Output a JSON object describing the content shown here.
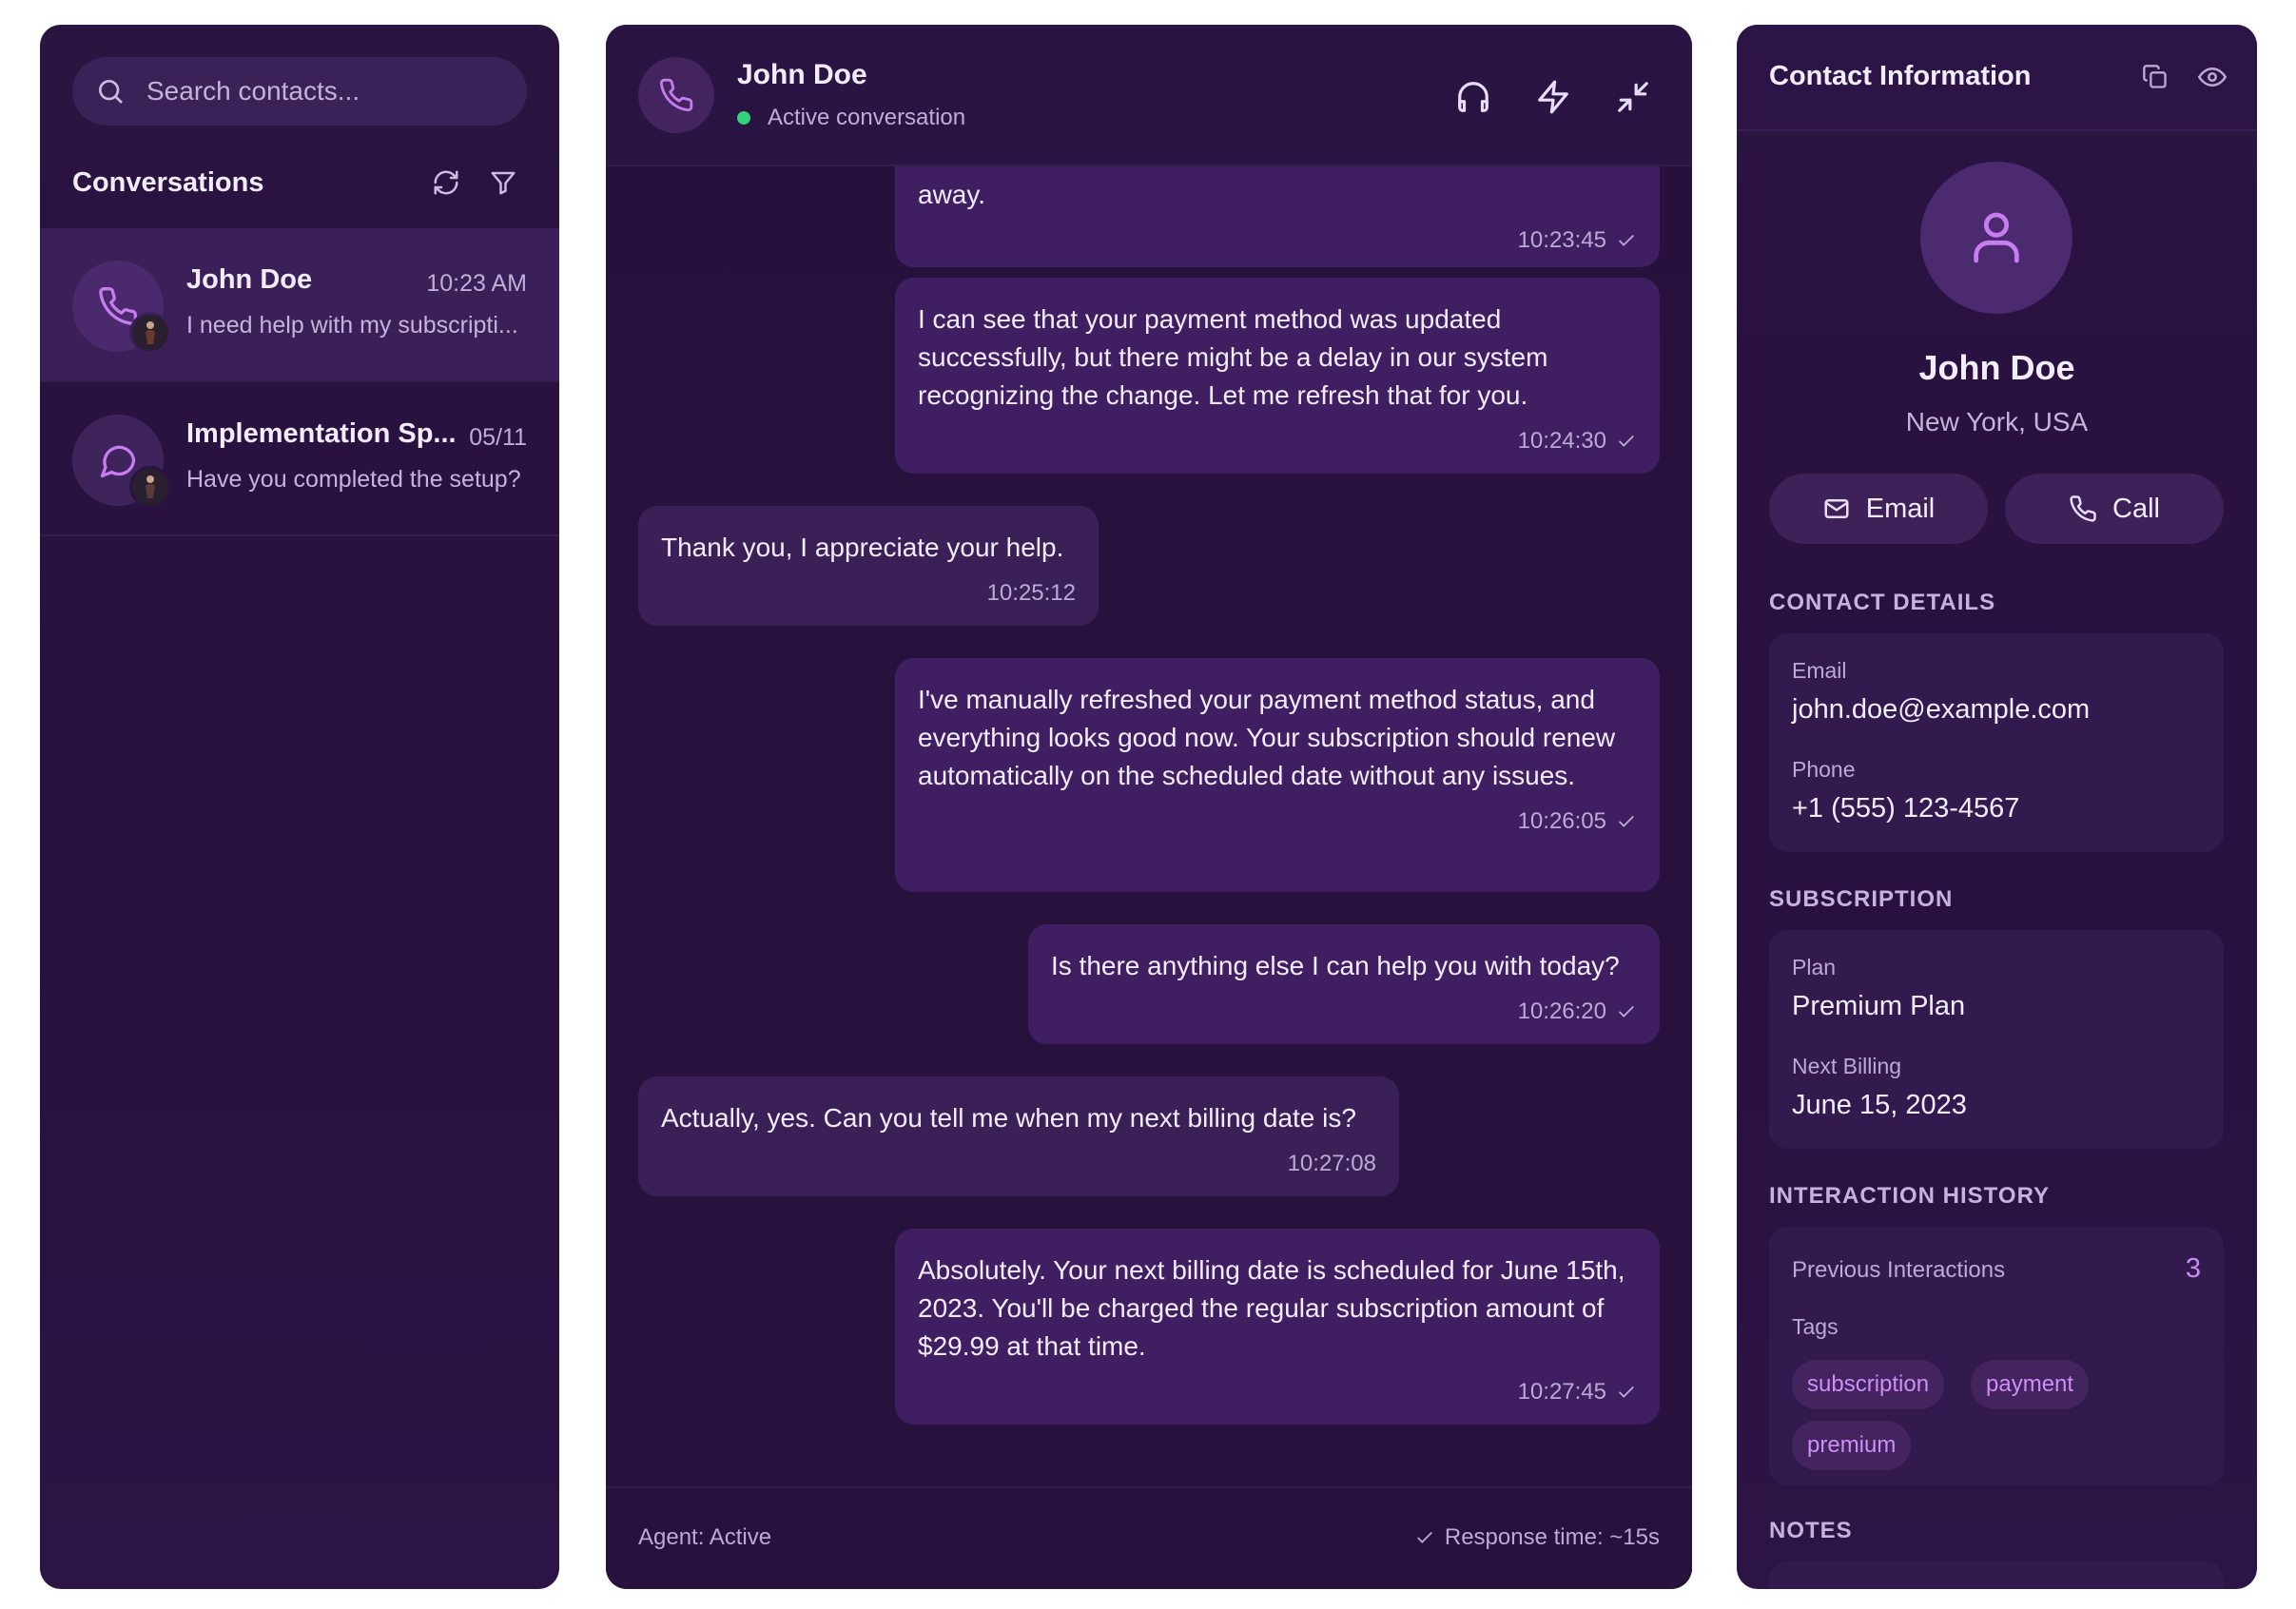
{
  "sidebar": {
    "search_placeholder": "Search contacts...",
    "title": "Conversations",
    "conversations": [
      {
        "name": "John Doe",
        "time": "10:23 AM",
        "preview": "I need help with my subscripti...",
        "channel": "phone-icon",
        "active": true
      },
      {
        "name": "Implementation Sp...",
        "time": "05/11",
        "preview": "Have you completed the setup?",
        "channel": "chat-bubble-icon",
        "active": false
      }
    ]
  },
  "chat": {
    "contact_name": "John Doe",
    "status": "Active conversation",
    "messages": [
      {
        "dir": "out",
        "text": "away.",
        "time": "10:23:45",
        "check": true
      },
      {
        "dir": "out",
        "text": "I can see that your payment method was updated successfully, but there might be a delay in our system recognizing the change. Let me refresh that for you.",
        "time": "10:24:30",
        "check": true
      },
      {
        "dir": "in",
        "text": "Thank you, I appreciate your help.",
        "time": "10:25:12",
        "check": false
      },
      {
        "dir": "out",
        "text": "I've manually refreshed your payment method status, and everything looks good now. Your subscription should renew automatically on the scheduled date without any issues.",
        "time": "10:26:05",
        "check": true
      },
      {
        "dir": "out",
        "text": "Is there anything else I can help you with today?",
        "time": "10:26:20",
        "check": true
      },
      {
        "dir": "in",
        "text": "Actually, yes. Can you tell me when my next billing date is?",
        "time": "10:27:08",
        "check": false
      },
      {
        "dir": "out",
        "text": "Absolutely. Your next billing date is scheduled for June 15th, 2023. You'll be charged the regular subscription amount of $29.99 at that time.",
        "time": "10:27:45",
        "check": true
      }
    ],
    "footer": {
      "agent": "Agent: Active",
      "response_time": "Response time: ~15s"
    }
  },
  "contact": {
    "title": "Contact Information",
    "name": "John Doe",
    "location": "New York, USA",
    "email_button": "Email",
    "call_button": "Call",
    "details_title": "CONTACT DETAILS",
    "email_label": "Email",
    "email": "john.doe@example.com",
    "phone_label": "Phone",
    "phone": "+1 (555) 123-4567",
    "subscription_title": "SUBSCRIPTION",
    "plan_label": "Plan",
    "plan": "Premium Plan",
    "billing_label": "Next Billing",
    "billing": "June 15, 2023",
    "history_title": "INTERACTION HISTORY",
    "prev_label": "Previous Interactions",
    "prev_count": "3",
    "tags_label": "Tags",
    "tags": [
      "subscription",
      "payment",
      "premium"
    ],
    "notes_title": "NOTES"
  },
  "colors": {
    "accent": "#c58df0",
    "online": "#33d17a",
    "background": "#2a1440"
  }
}
